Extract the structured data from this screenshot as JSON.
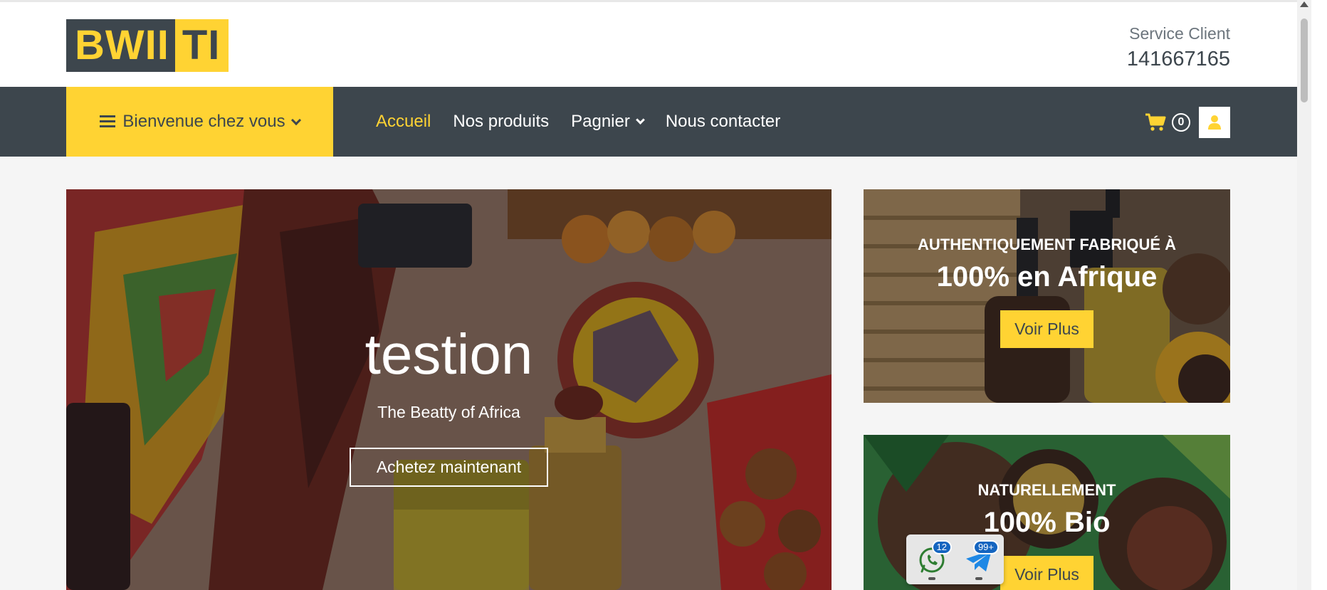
{
  "header": {
    "logo_part1": "BWII",
    "logo_part2": "TI",
    "service_label": "Service Client",
    "service_phone": "141667165"
  },
  "nav": {
    "category_button": "Bienvenue chez vous",
    "links": [
      {
        "label": "Accueil",
        "active": true
      },
      {
        "label": "Nos produits",
        "active": false
      },
      {
        "label": "Pagnier",
        "active": false,
        "dropdown": true
      },
      {
        "label": "Nous contacter",
        "active": false
      }
    ],
    "cart_count": "0"
  },
  "hero": {
    "title": "testion",
    "subtitle": "The Beatty of Africa",
    "button": "Achetez maintenant"
  },
  "offers": [
    {
      "kicker": "AUTHENTIQUEMENT FABRIQUÉ À",
      "title": "100% en Afrique",
      "button": "Voir Plus"
    },
    {
      "kicker": "NATURELLEMENT",
      "title": "100% Bio",
      "button": "Voir Plus"
    }
  ],
  "widget": {
    "whatsapp_badge": "12",
    "telegram_badge": "99+"
  },
  "colors": {
    "accent": "#ffd333",
    "dark": "#3d464d"
  },
  "icons": [
    "menu-icon",
    "chevron-down-icon",
    "cart-icon",
    "user-icon",
    "whatsapp-icon",
    "telegram-icon"
  ]
}
